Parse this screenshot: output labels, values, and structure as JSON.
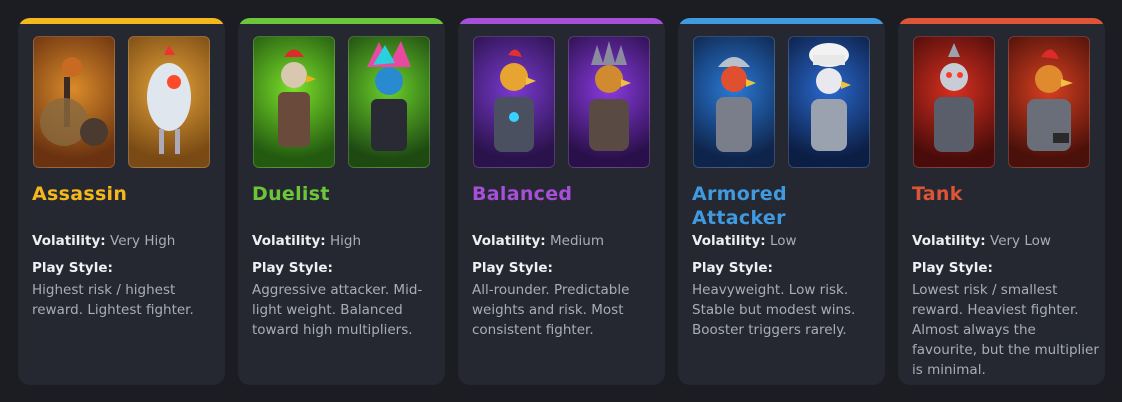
{
  "cards": [
    {
      "title": "Assassin",
      "accent": "#f4b81c",
      "volatility_label": "Volatility:",
      "volatility": "Very High",
      "playstyle_label": "Play Style:",
      "description": "Highest risk / highest reward. Lightest fighter.",
      "images": [
        "robot-rooster-with-shield",
        "egg-shaped-robot-rooster"
      ]
    },
    {
      "title": "Duelist",
      "accent": "#6cc639",
      "volatility_label": "Volatility:",
      "volatility": "High",
      "playstyle_label": "Play Style:",
      "description": "Aggressive attacker. Mid-light weight. Balanced toward high multipliers.",
      "images": [
        "red-crest-rooster-fighter",
        "punk-crest-rooster-fighter"
      ]
    },
    {
      "title": "Balanced",
      "accent": "#a64fd9",
      "volatility_label": "Volatility:",
      "volatility": "Medium",
      "playstyle_label": "Play Style:",
      "description": "All-rounder. Predictable weights and risk. Most consistent fighter.",
      "images": [
        "armored-rooster-purple",
        "spiked-helmet-rooster-purple"
      ]
    },
    {
      "title": "Armored Attacker",
      "accent": "#3f9ae0",
      "volatility_label": "Volatility:",
      "volatility": "Low",
      "playstyle_label": "Play Style:",
      "description": "Heavyweight. Low risk. Stable but modest wins. Booster triggers rarely.",
      "images": [
        "helmeted-rooster-blue",
        "chef-hat-rooster-blue"
      ]
    },
    {
      "title": "Tank",
      "accent": "#de5436",
      "volatility_label": "Volatility:",
      "volatility": "Very Low",
      "playstyle_label": "Play Style:",
      "description": "Lowest risk / smallest reward. Heaviest fighter. Almost always the favourite, but the multiplier is minimal.",
      "images": [
        "cyber-rooster-red",
        "armored-rooster-red"
      ]
    }
  ]
}
